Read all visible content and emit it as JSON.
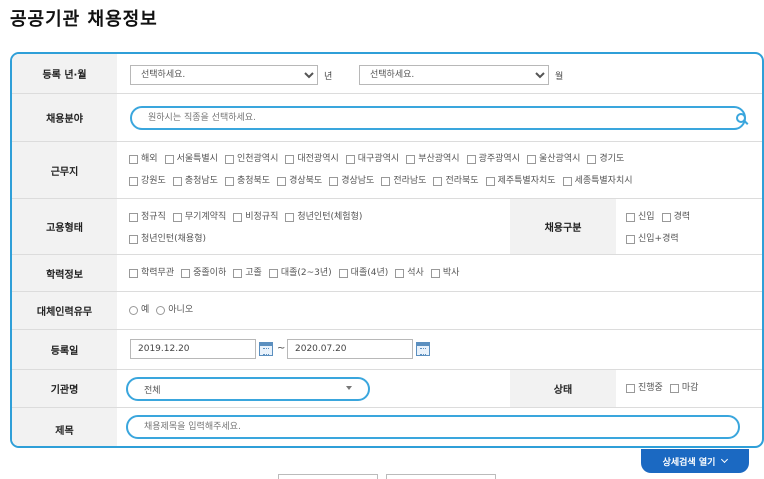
{
  "page_title": "공공기관 채용정보",
  "form": {
    "reg_period": {
      "label": "등록 년·월",
      "year_value": "선택하세요.",
      "year_unit": "년",
      "month_value": "선택하세요.",
      "month_unit": "월"
    },
    "job_field": {
      "label": "채용분야",
      "placeholder": "원하시는 직종을 선택하세요."
    },
    "location": {
      "label": "근무지",
      "options": [
        "해외",
        "서울특별시",
        "인천광역시",
        "대전광역시",
        "대구광역시",
        "부산광역시",
        "광주광역시",
        "울산광역시",
        "경기도",
        "강원도",
        "충청남도",
        "충청북도",
        "경상북도",
        "경상남도",
        "전라남도",
        "전라북도",
        "제주특별자치도",
        "세종특별자치시"
      ]
    },
    "employment_type": {
      "label": "고용형태",
      "options": [
        "정규직",
        "무기계약직",
        "비정규직",
        "청년인턴(체험형)",
        "청년인턴(채용형)"
      ]
    },
    "hire_class": {
      "label": "채용구분",
      "options": [
        "신입",
        "경력",
        "신입+경력"
      ]
    },
    "education": {
      "label": "학력정보",
      "options": [
        "학력무관",
        "중졸이하",
        "고졸",
        "대졸(2~3년)",
        "대졸(4년)",
        "석사",
        "박사"
      ]
    },
    "substitute": {
      "label": "대체인력유무",
      "options": [
        "예",
        "아니오"
      ]
    },
    "reg_date": {
      "label": "등록일",
      "from": "2019.12.20",
      "separator": "~",
      "to": "2020.07.20"
    },
    "agency": {
      "label": "기관명",
      "value": "전체"
    },
    "status": {
      "label": "상태",
      "options": [
        "진행중",
        "마감"
      ]
    },
    "title": {
      "label": "제목",
      "placeholder": "채용제목을 입력해주세요."
    }
  },
  "detail_toggle_label": "상세검색 열기",
  "icons": {
    "search": "search-icon",
    "calendar": "calendar-icon",
    "chevron": "chevron-down-icon"
  },
  "colors": {
    "accent_border": "#2f9fd8",
    "button_bg": "#1b69c2",
    "label_bg": "#f2f2f2"
  }
}
